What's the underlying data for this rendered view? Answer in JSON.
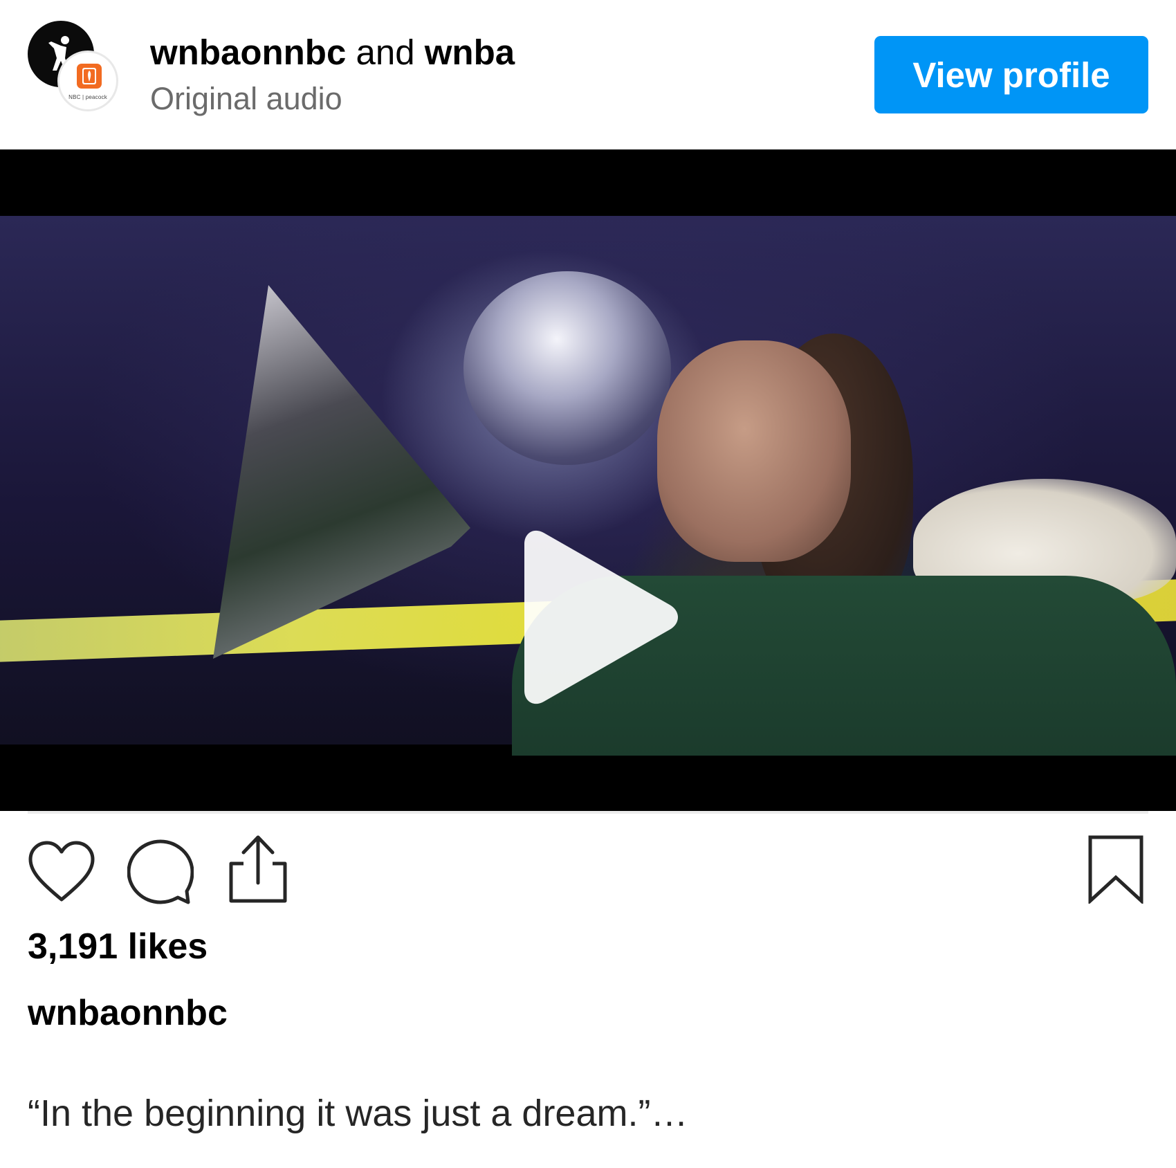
{
  "header": {
    "account_primary": "wnbaonnbc",
    "connector": "and",
    "account_secondary": "wnba",
    "audio": "Original audio",
    "view_profile_label": "View profile",
    "logo_caption": "NBC | peacock"
  },
  "video": {
    "state": "paused",
    "play_icon": "play-icon"
  },
  "actions": {
    "like_icon": "heart-icon",
    "comment_icon": "comment-icon",
    "share_icon": "share-icon",
    "save_icon": "bookmark-icon"
  },
  "stats": {
    "likes": "3,191 likes"
  },
  "caption": {
    "username": "wnbaonnbc",
    "text": "“In the beginning it was just a dream.”…"
  },
  "colors": {
    "accent": "#0095f6",
    "logo_orange": "#f26b21"
  }
}
